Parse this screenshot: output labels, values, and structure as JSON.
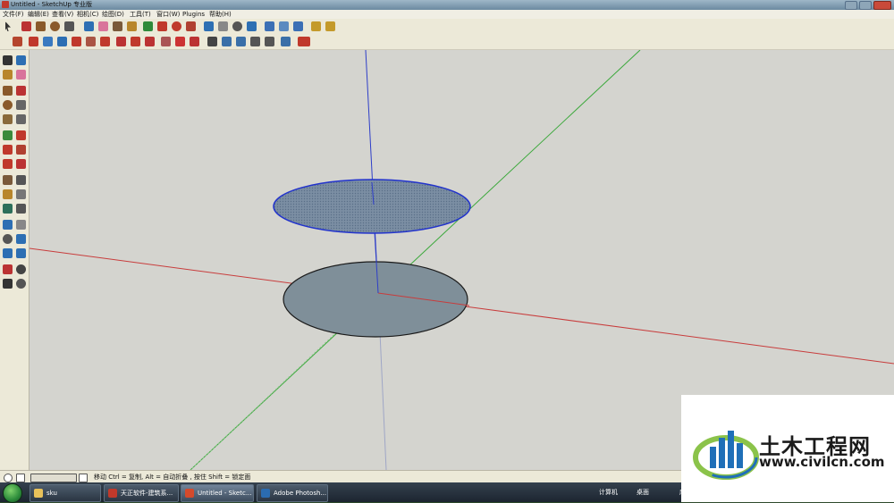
{
  "window": {
    "title": "Untitled - SketchUp 专业版"
  },
  "menu": [
    {
      "label": "文件(F)"
    },
    {
      "label": "编辑(E)"
    },
    {
      "label": "查看(V)"
    },
    {
      "label": "相机(C)"
    },
    {
      "label": "绘图(D)"
    },
    {
      "label": "工具(T)"
    },
    {
      "label": "窗口(W)"
    },
    {
      "label": "Plugins"
    },
    {
      "label": "帮助(H)"
    }
  ],
  "status_bar": {
    "hint": "移动 Ctrl = 复制, Alt = 自动折叠 , 按住 Shift = 锁定面"
  },
  "taskbar": {
    "items": [
      {
        "label": "sku",
        "icon": "folder-icon",
        "color": "#e8c15a"
      },
      {
        "label": "天正软件-建筑系...",
        "icon": "tangent-app-icon",
        "color": "#c0392b"
      },
      {
        "label": "Untitled - Sketc...",
        "icon": "sketchup-icon",
        "color": "#d44a2c",
        "active": true
      },
      {
        "label": "Adobe Photosh...",
        "icon": "photoshop-icon",
        "color": "#2b6cb0"
      }
    ],
    "tray_label": "计算机",
    "tray_label2": "桌面",
    "tray_label3": "库"
  },
  "watermark": {
    "title": "土木工程网",
    "url": "www.civilcn.com"
  },
  "scene": {
    "axes": {
      "red": "#c83c3c",
      "green": "#3aa83a",
      "blue": "#2e3ec8"
    },
    "upper_disc": {
      "fill": "#7b8ea3",
      "stroke": "#2233cc",
      "selected": true
    },
    "lower_disc": {
      "fill": "#7f8f99",
      "stroke": "#1a1a1a",
      "selected": false
    }
  }
}
